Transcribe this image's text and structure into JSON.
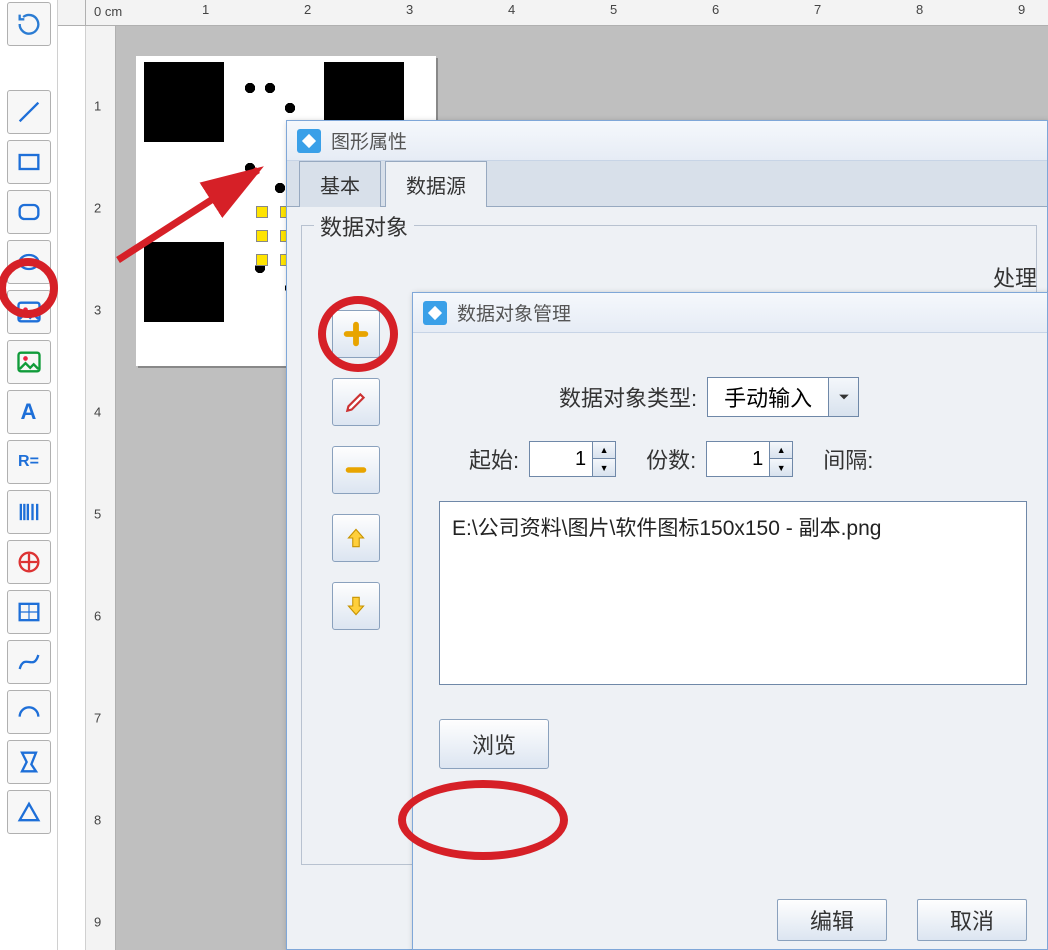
{
  "ruler": {
    "unit_label": "0 cm",
    "h_ticks": [
      "1",
      "2",
      "3",
      "4",
      "5",
      "6",
      "7",
      "8",
      "9"
    ],
    "v_ticks": [
      "1",
      "2",
      "3",
      "4",
      "5",
      "6",
      "7",
      "8",
      "9"
    ]
  },
  "tools": [
    {
      "name": "rotate-refresh-icon"
    },
    {
      "name": "line-tool-icon"
    },
    {
      "name": "rectangle-tool-icon"
    },
    {
      "name": "rounded-rect-tool-icon"
    },
    {
      "name": "ellipse-tool-icon"
    },
    {
      "name": "image-tool-icon"
    },
    {
      "name": "vector-image-tool-icon"
    },
    {
      "name": "text-tool-icon",
      "text": "A"
    },
    {
      "name": "rich-text-tool-icon",
      "text": "R="
    },
    {
      "name": "barcode-tool-icon"
    },
    {
      "name": "qrcode-tool-icon"
    },
    {
      "name": "table-tool-icon"
    },
    {
      "name": "curve-tool-icon"
    },
    {
      "name": "arc-tool-icon"
    },
    {
      "name": "polygon-tool-icon"
    },
    {
      "name": "triangle-tool-icon"
    }
  ],
  "dialog1": {
    "title": "图形属性",
    "tabs": {
      "basic": "基本",
      "datasource": "数据源"
    },
    "active_tab": "datasource",
    "group_label": "数据对象",
    "process_label": "处理"
  },
  "obj_buttons": {
    "add": "add-object-button",
    "edit": "edit-object-button",
    "remove": "remove-object-button",
    "up": "move-up-button",
    "down": "move-down-button"
  },
  "dialog2": {
    "title": "数据对象管理",
    "type_label": "数据对象类型:",
    "type_value": "手动输入",
    "start_label": "起始:",
    "start_value": "1",
    "count_label": "份数:",
    "count_value": "1",
    "interval_label": "间隔:",
    "path_value": "E:\\公司资料\\图片\\软件图标150x150 - 副本.png",
    "browse_label": "浏览",
    "edit_label": "编辑",
    "cancel_label": "取消"
  }
}
